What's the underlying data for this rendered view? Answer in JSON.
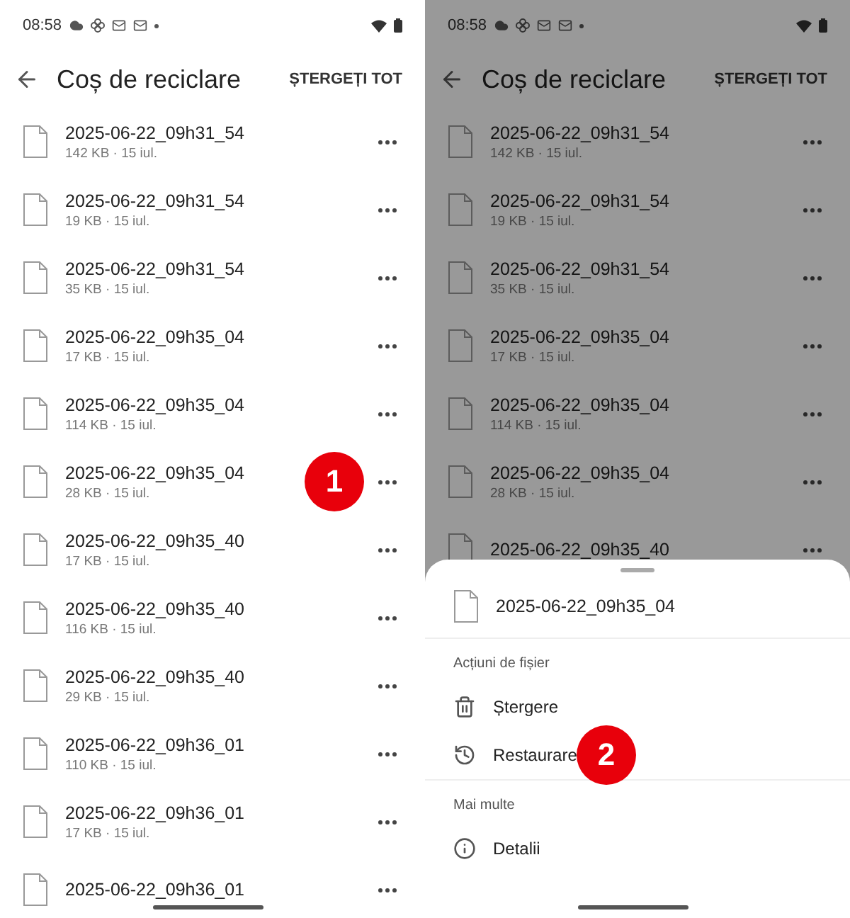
{
  "screens": [
    {
      "status_bar": {
        "time": "08:58"
      },
      "header": {
        "title": "Coș de reciclare",
        "action": "ȘTERGEȚI TOT"
      },
      "files": [
        {
          "name": "2025-06-22_09h31_54",
          "meta": "142 KB · 15 iul."
        },
        {
          "name": "2025-06-22_09h31_54",
          "meta": "19 KB · 15 iul."
        },
        {
          "name": "2025-06-22_09h31_54",
          "meta": "35 KB · 15 iul."
        },
        {
          "name": "2025-06-22_09h35_04",
          "meta": "17 KB · 15 iul."
        },
        {
          "name": "2025-06-22_09h35_04",
          "meta": "114 KB · 15 iul."
        },
        {
          "name": "2025-06-22_09h35_04",
          "meta": "28 KB · 15 iul.",
          "callout": "1"
        },
        {
          "name": "2025-06-22_09h35_40",
          "meta": "17 KB · 15 iul."
        },
        {
          "name": "2025-06-22_09h35_40",
          "meta": "116 KB · 15 iul."
        },
        {
          "name": "2025-06-22_09h35_40",
          "meta": "29 KB · 15 iul."
        },
        {
          "name": "2025-06-22_09h36_01",
          "meta": "110 KB · 15 iul."
        },
        {
          "name": "2025-06-22_09h36_01",
          "meta": "17 KB · 15 iul."
        },
        {
          "name": "2025-06-22_09h36_01"
        }
      ]
    },
    {
      "status_bar": {
        "time": "08:58"
      },
      "header": {
        "title": "Coș de reciclare",
        "action": "ȘTERGEȚI TOT"
      },
      "files": [
        {
          "name": "2025-06-22_09h31_54",
          "meta": "142 KB · 15 iul."
        },
        {
          "name": "2025-06-22_09h31_54",
          "meta": "19 KB · 15 iul."
        },
        {
          "name": "2025-06-22_09h31_54",
          "meta": "35 KB · 15 iul."
        },
        {
          "name": "2025-06-22_09h35_04",
          "meta": "17 KB · 15 iul."
        },
        {
          "name": "2025-06-22_09h35_04",
          "meta": "114 KB · 15 iul."
        },
        {
          "name": "2025-06-22_09h35_04",
          "meta": "28 KB · 15 iul."
        },
        {
          "name": "2025-06-22_09h35_40"
        }
      ],
      "sheet": {
        "file": "2025-06-22_09h35_04",
        "sections": [
          {
            "title": "Acțiuni de fișier",
            "actions": [
              {
                "kind": "delete",
                "label": "Ștergere"
              },
              {
                "kind": "restore",
                "label": "Restaurare",
                "callout": "2"
              }
            ]
          },
          {
            "title": "Mai multe",
            "actions": [
              {
                "kind": "details",
                "label": "Detalii"
              }
            ]
          }
        ]
      }
    }
  ]
}
